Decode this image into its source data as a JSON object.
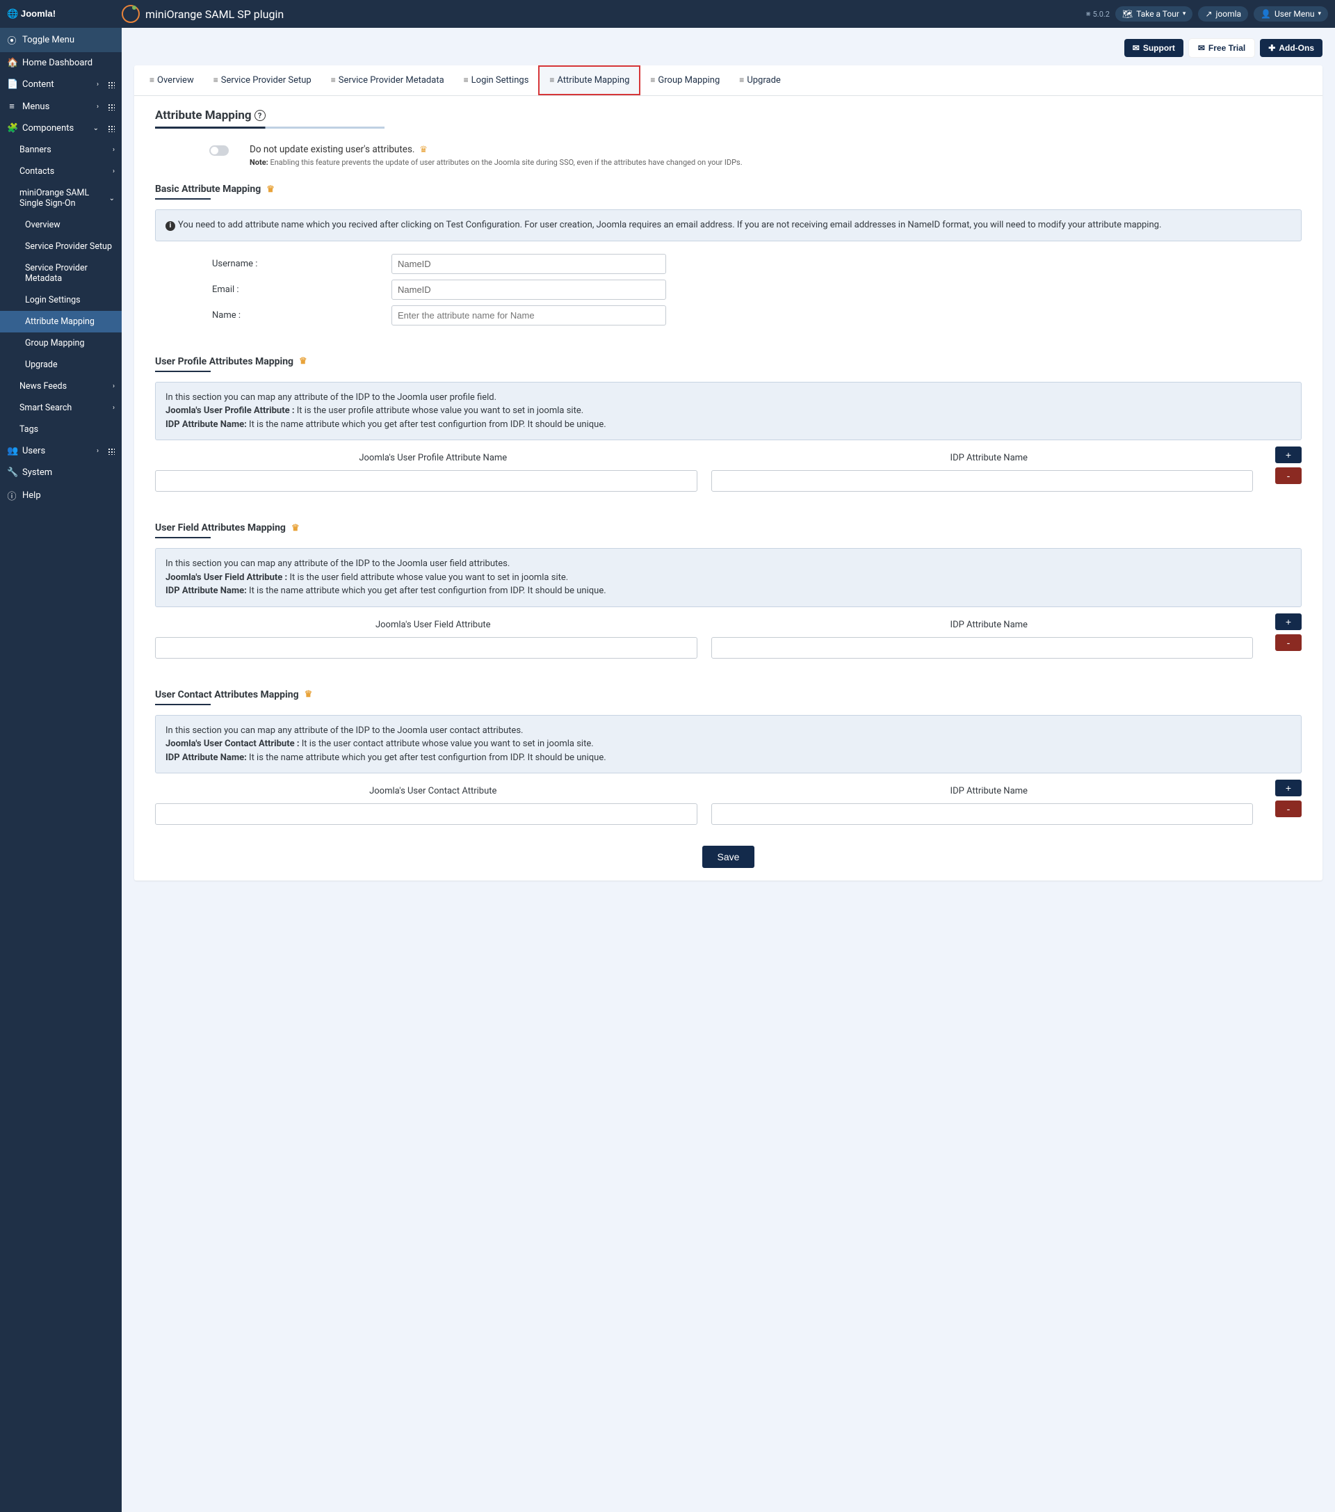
{
  "topbar": {
    "brand": "Joomla!",
    "plugin_title": "miniOrange SAML SP plugin",
    "version": "5.0.2",
    "take_tour": "Take a Tour",
    "site_link": "joomla",
    "user_menu": "User Menu"
  },
  "actionbar": {
    "support": "Support",
    "free_trial": "Free Trial",
    "addons": "Add-Ons"
  },
  "sidebar": {
    "toggle": "Toggle Menu",
    "home": "Home Dashboard",
    "content": "Content",
    "menus": "Menus",
    "components": "Components",
    "banners": "Banners",
    "contacts": "Contacts",
    "mo_saml": "miniOrange SAML Single Sign-On",
    "overview": "Overview",
    "sp_setup": "Service Provider Setup",
    "sp_metadata": "Service Provider Metadata",
    "login_settings": "Login Settings",
    "attr_mapping": "Attribute Mapping",
    "group_mapping": "Group Mapping",
    "upgrade": "Upgrade",
    "news_feeds": "News Feeds",
    "smart_search": "Smart Search",
    "tags": "Tags",
    "users": "Users",
    "system": "System",
    "help": "Help"
  },
  "tabs": {
    "overview": "Overview",
    "sp_setup": "Service Provider Setup",
    "sp_metadata": "Service Provider Metadata",
    "login_settings": "Login Settings",
    "attr_mapping": "Attribute Mapping",
    "group_mapping": "Group Mapping",
    "upgrade": "Upgrade"
  },
  "page": {
    "title": "Attribute Mapping",
    "toggle_label": "Do not update existing user's attributes.",
    "toggle_note_b": "Note:",
    "toggle_note": " Enabling this feature prevents the update of user attributes on the Joomla site during SSO, even if the attributes have changed on your IDPs.",
    "basic_title": "Basic Attribute Mapping",
    "basic_info": "You need to add attribute name which you recived after clicking on Test Configuration. For user creation, Joomla requires an email address. If you are not receiving email addresses in NameID format, you will need to modify your attribute mapping.",
    "username_label": "Username :",
    "username_value": "NameID",
    "email_label": "Email :",
    "email_value": "NameID",
    "name_label": "Name :",
    "name_placeholder": "Enter the attribute name for Name",
    "profile_title": "User Profile Attributes Mapping",
    "profile_info_1": "In this section you can map any attribute of the IDP to the Joomla user profile field.",
    "profile_info_2a": "Joomla's User Profile Attribute :",
    "profile_info_2b": " It is the user profile attribute whose value you want to set in joomla site.",
    "profile_info_3a": "IDP Attribute Name:",
    "profile_info_3b": " It is the name attribute which you get after test configurtion from IDP. It should be unique.",
    "profile_col1": "Joomla's User Profile Attribute Name",
    "idp_col": "IDP Attribute Name",
    "field_title": "User Field Attributes Mapping",
    "field_info_1": "In this section you can map any attribute of the IDP to the Joomla user field attributes.",
    "field_info_2a": "Joomla's User Field Attribute :",
    "field_info_2b": " It is the user field attribute whose value you want to set in joomla site.",
    "field_col1": "Joomla's User Field Attribute",
    "contact_title": "User Contact Attributes Mapping",
    "contact_info_1": "In this section you can map any attribute of the IDP to the Joomla user contact attributes.",
    "contact_info_2a": "Joomla's User Contact Attribute :",
    "contact_info_2b": " It is the user contact attribute whose value you want to set in joomla site.",
    "contact_col1": "Joomla's User Contact Attribute",
    "save": "Save"
  }
}
